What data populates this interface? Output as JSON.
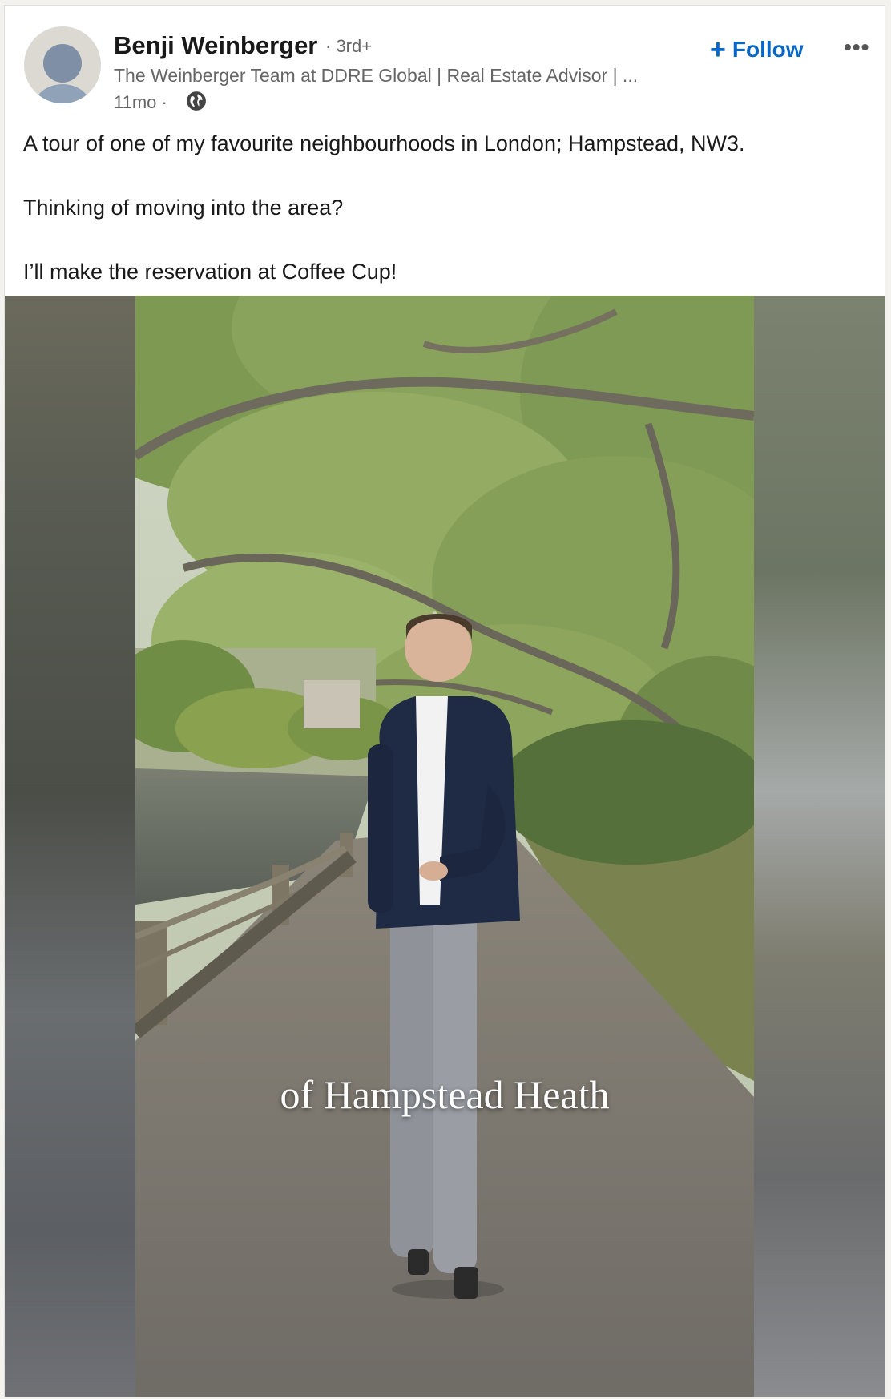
{
  "post": {
    "author_name": "Benji Weinberger",
    "connection_degree": "· 3rd+",
    "headline": "The Weinberger Team at DDRE Global | Real Estate Advisor | ...",
    "time_ago": "11mo ·",
    "follow_label": "Follow",
    "more_label": "•••",
    "text_lines": [
      "A tour of one of my favourite neighbourhoods in London; Hampstead, NW3.",
      "Thinking of moving into the area?",
      "I’ll make the reservation at Coffee Cup!"
    ]
  },
  "video": {
    "caption": "of Hampstead Heath"
  },
  "colors": {
    "link_blue": "#0a66c2",
    "muted_text": "#666666",
    "primary_text": "#191919"
  },
  "icons": [
    "globe-icon",
    "plus-icon",
    "more-icon"
  ]
}
